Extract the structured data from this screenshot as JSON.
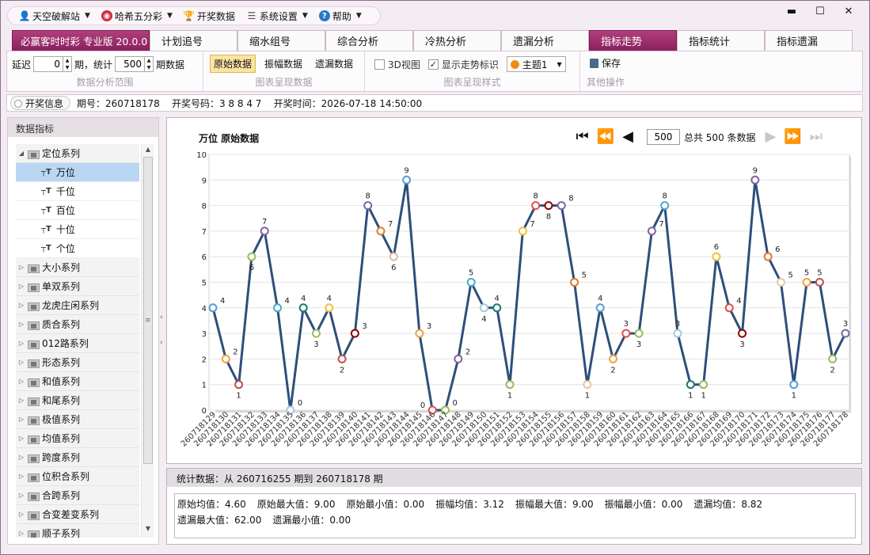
{
  "menu": [
    {
      "label": "天空破解站",
      "icon": "user-icon",
      "color": "#2a78c7"
    },
    {
      "label": "哈希五分彩",
      "icon": "target-icon",
      "color": "#d12b3f"
    },
    {
      "label": "开奖数据",
      "icon": "trophy-icon",
      "color": "#e39b13"
    },
    {
      "label": "系统设置",
      "icon": "settings-sliders-icon",
      "color": "#555555"
    },
    {
      "label": "帮助",
      "icon": "help-icon",
      "color": "#2a78c7"
    }
  ],
  "window_buttons": {
    "minimize": "▬",
    "maximize": "☐",
    "close": "✕"
  },
  "tabs": [
    {
      "label": "必赢客时时彩 专业版 20.0.0",
      "kind": "brand"
    },
    {
      "label": "计划追号"
    },
    {
      "label": "缩水组号"
    },
    {
      "label": "综合分析"
    },
    {
      "label": "冷热分析"
    },
    {
      "label": "遗漏分析"
    },
    {
      "label": "指标走势",
      "kind": "active"
    },
    {
      "label": "指标统计"
    },
    {
      "label": "指标遗漏"
    }
  ],
  "ribbon": {
    "delay_label": "延迟",
    "delay_value": "0",
    "period_label": "期，统计",
    "count_value": "500",
    "count_suffix": "期数据",
    "group1_title": "数据分析范围",
    "btn_raw": "原始数据",
    "btn_amplitude": "振幅数据",
    "btn_missing": "遗漏数据",
    "group2_title": "图表呈现数据",
    "view3d_label": "3D视图",
    "view3d_checked": false,
    "show_trend_label": "显示走势标识",
    "show_trend_checked": true,
    "theme_value": "主题1",
    "group3_title": "图表呈现样式",
    "save_label": "保存",
    "group4_title": "其他操作"
  },
  "infobar": {
    "button_label": "开奖信息",
    "text": "期号：260718178    开奖号码：3 8 8 4 7    开奖时间：2026-07-18 14:50:00"
  },
  "sidebar": {
    "title": "数据指标",
    "tree": [
      {
        "label": "定位系列",
        "expanded": true,
        "children": [
          "万位",
          "千位",
          "百位",
          "十位",
          "个位"
        ],
        "selected": "万位"
      },
      {
        "label": "大小系列"
      },
      {
        "label": "单双系列"
      },
      {
        "label": "龙虎庄闲系列"
      },
      {
        "label": "质合系列"
      },
      {
        "label": "012路系列"
      },
      {
        "label": "形态系列"
      },
      {
        "label": "和值系列"
      },
      {
        "label": "和尾系列"
      },
      {
        "label": "极值系列"
      },
      {
        "label": "均值系列"
      },
      {
        "label": "跨度系列"
      },
      {
        "label": "位积合系列"
      },
      {
        "label": "合跨系列"
      },
      {
        "label": "合变差变系列"
      },
      {
        "label": "顺子系列"
      }
    ]
  },
  "chart_nav": {
    "page_value": "500",
    "total_text": "总共 500 条数据"
  },
  "chart_data": {
    "type": "line",
    "title": "万位 原始数据",
    "ylim": [
      0,
      10
    ],
    "yticks": [
      0,
      1,
      2,
      3,
      4,
      5,
      6,
      7,
      8,
      9,
      10
    ],
    "grid": true,
    "x": [
      "260718129",
      "260718130",
      "260718131",
      "260718132",
      "260718133",
      "260718134",
      "260718135",
      "260718136",
      "260718137",
      "260718138",
      "260718139",
      "260718140",
      "260718141",
      "260718142",
      "260718143",
      "260718144",
      "260718145",
      "260718146",
      "260718147",
      "260718148",
      "260718149",
      "260718150",
      "260718151",
      "260718152",
      "260718153",
      "260718154",
      "260718155",
      "260718156",
      "260718157",
      "260718158",
      "260718159",
      "260718160",
      "260718161",
      "260718162",
      "260718163",
      "260718164",
      "260718165",
      "260718166",
      "260718167",
      "260718168",
      "260718169",
      "260718170",
      "260718171",
      "260718172",
      "260718173",
      "260718174",
      "260718175",
      "260718176",
      "260718177",
      "260718178"
    ],
    "values": [
      4,
      2,
      1,
      6,
      7,
      4,
      0,
      4,
      3,
      4,
      2,
      3,
      8,
      7,
      6,
      9,
      3,
      0,
      0,
      2,
      5,
      4,
      4,
      1,
      7,
      8,
      8,
      8,
      5,
      1,
      4,
      2,
      3,
      3,
      7,
      8,
      3,
      1,
      1,
      6,
      4,
      3,
      9,
      6,
      5,
      1,
      5,
      5,
      2,
      3
    ],
    "label_pos": [
      "r",
      "r",
      "b",
      "b",
      "t",
      "r",
      "r",
      "t",
      "b",
      "t",
      "b",
      "r",
      "t",
      "r",
      "b",
      "t",
      "r",
      "l",
      "r",
      "r",
      "t",
      "b",
      "t",
      "b",
      "r",
      "t",
      "b",
      "r",
      "r",
      "b",
      "t",
      "b",
      "t",
      "b",
      "r",
      "t",
      "t",
      "b",
      "b",
      "t",
      "r",
      "b",
      "t",
      "r",
      "r",
      "b",
      "t",
      "t",
      "b",
      "t"
    ],
    "line_color": "#2e4f7a",
    "marker_colors": [
      "#5b9bd5",
      "#f2a03d",
      "#c0504d",
      "#9bbb59",
      "#8064a2",
      "#4bacc6",
      "#a5c8e1",
      "#1f7a6e",
      "#9bbb59",
      "#f0c23c",
      "#c0504d",
      "#8b0000",
      "#8064a2",
      "#d9822b",
      "#e8b89a",
      "#5b9bd5",
      "#f0a040",
      "#e05050",
      "#9bbb59",
      "#8064a2",
      "#4bacc6",
      "#a5c8e1",
      "#1f7a6e",
      "#9bbb59",
      "#f0c23c",
      "#e05050",
      "#8b0000",
      "#8064a2",
      "#e07a2b",
      "#e8c8a0",
      "#5b9bd5",
      "#f0a040",
      "#e05050",
      "#9bbb59",
      "#8064a2",
      "#4bacc6",
      "#a5c8e1",
      "#1f7a6e",
      "#9bbb59",
      "#f0c23c",
      "#e05050",
      "#8b0000",
      "#8064a2",
      "#e07a2b",
      "#e8c8a0",
      "#5b9bd5",
      "#f0a040",
      "#c0504d",
      "#9bbb59",
      "#8064a2"
    ]
  },
  "stats": {
    "header": "统计数据：从 260716255 期到 260718178 期",
    "items": [
      "原始均值：4.60",
      "原始最大值：9.00",
      "原始最小值：0.00",
      "振幅均值：3.12",
      "振幅最大值：9.00",
      "振幅最小值：0.00",
      "遗漏均值：8.82",
      "遗漏最大值：62.00",
      "遗漏最小值：0.00"
    ]
  }
}
